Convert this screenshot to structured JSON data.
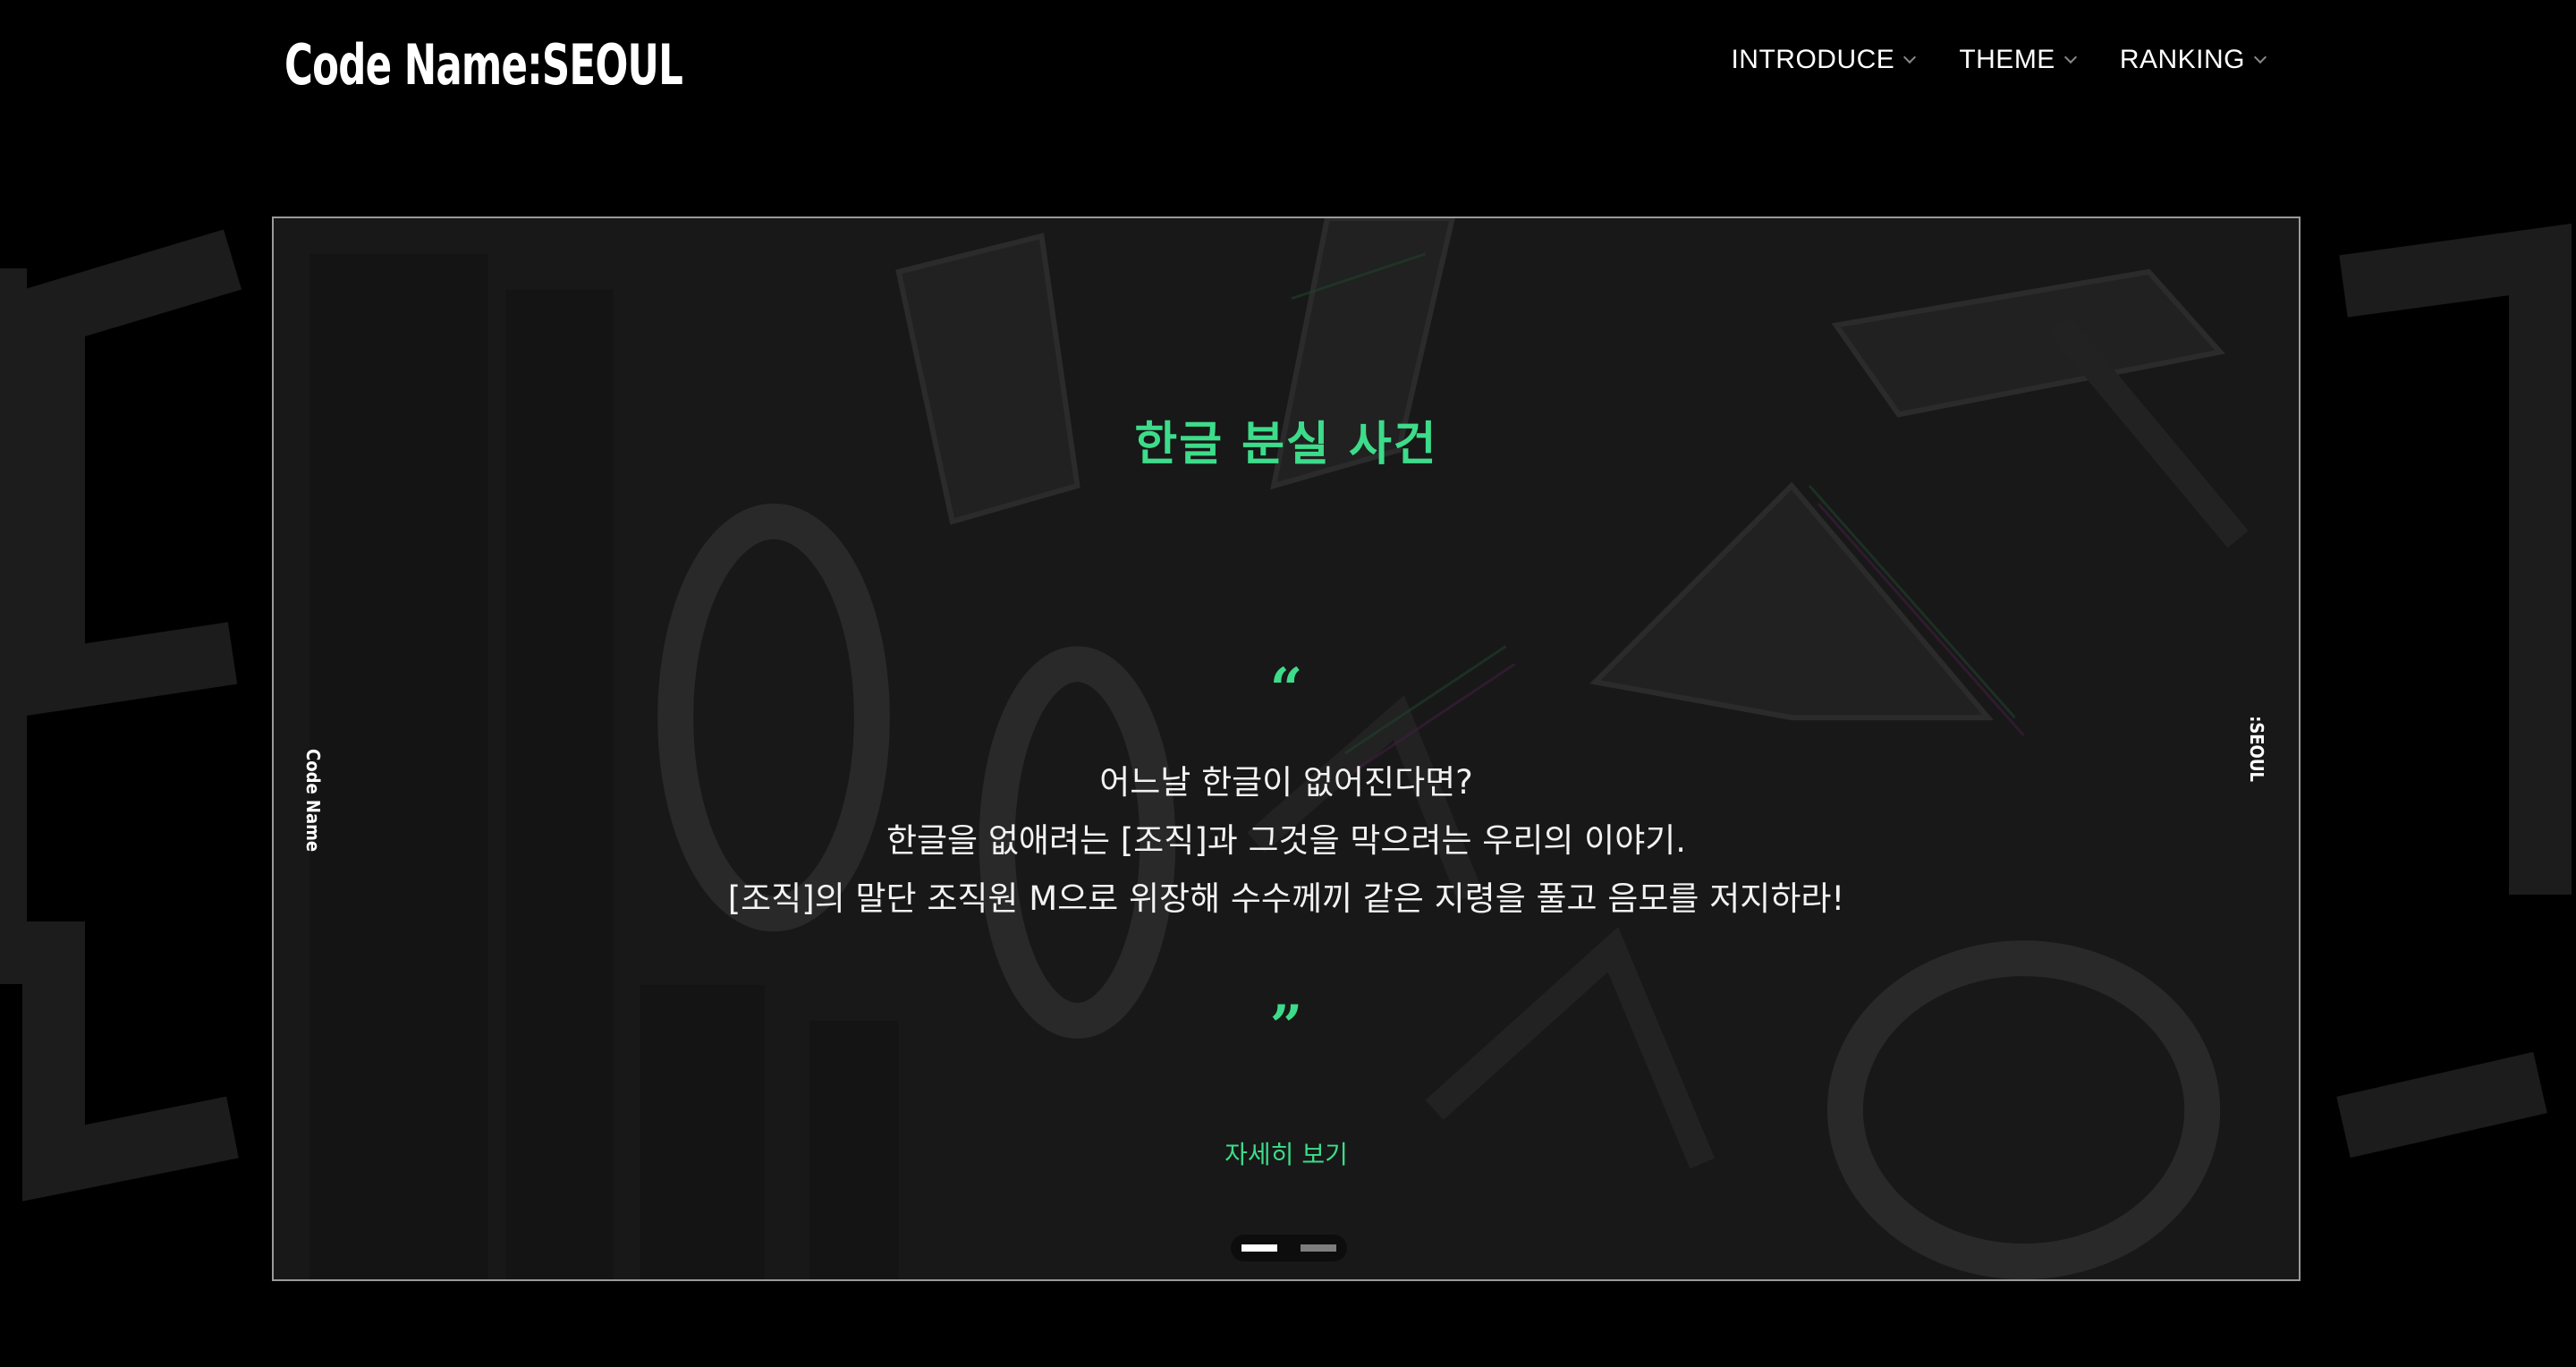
{
  "header": {
    "logo": "Code Name:SEOUL",
    "nav": [
      {
        "label": "INTRODUCE"
      },
      {
        "label": "THEME"
      },
      {
        "label": "RANKING"
      }
    ]
  },
  "slider": {
    "side_left": "Code Name",
    "side_right": ":SEOUL",
    "title": "한글 분실 사건",
    "quote_open": "“",
    "quote_close": "”",
    "lines": [
      "어느날 한글이 없어진다면?",
      "한글을 없애려는 [조직]과 그것을 막으려는 우리의 이야기.",
      "[조직]의 말단 조직원 M으로 위장해 수수께끼 같은 지령을 풀고 음모를 저지하라!"
    ],
    "more_label": "자세히 보기",
    "dots": 2,
    "active_dot": 1
  },
  "colors": {
    "accent": "#3ddc8a",
    "background": "#000000",
    "frame": "#9a9a9a"
  }
}
